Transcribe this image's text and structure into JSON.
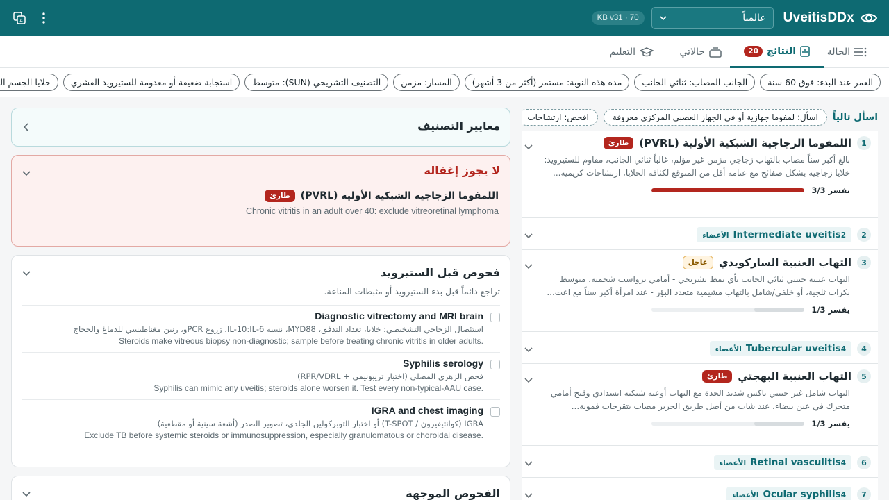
{
  "app": {
    "brand": "UveitisDDx",
    "region": "عالمياً",
    "kb_version": "KB v31 · 70"
  },
  "tabs": [
    {
      "label": "الحالة",
      "icon": "list-icon"
    },
    {
      "label": "النتائج",
      "count": "20",
      "icon": "chart-doc-icon",
      "active": true
    },
    {
      "label": "حالاتي",
      "icon": "stack-icon"
    },
    {
      "label": "التعليم",
      "icon": "graduation-cap-icon"
    }
  ],
  "chips": [
    "العمر عند البدء: فوق 60 سنة",
    "الجانب المصاب: ثنائي الجانب",
    "مدة هذه النوبة: مستمر (أكثر من 3 أشهر)",
    "المسار: مزمن",
    "التصنيف التشريحي (SUN): متوسط",
    "استجابة ضعيفة أو معدومة للستيرويد القشري",
    "خلايا الجسم الزجاجي"
  ],
  "ask_next": {
    "label": "اسأل تالياً",
    "items": [
      "اسأل: لمفوما جهازية أو في الجهاز العصبي المركزي معروفة",
      "افحص: ارتشاحات"
    ]
  },
  "results": [
    {
      "rank": "1",
      "title": "اللمفوما الزجاجية الشبكية الأولية (PVRL)",
      "badge": "طارئ",
      "badge_type": "red",
      "desc": "بالغ أكبر سناً مصاب بالتهاب زجاجي مزمن غير مؤلم، غالباً ثنائي الجانب، مقاوم للستيرويد: خلايا زجاجية بشكل صفائح مع عتامة أقل من المتوقع لكثافة الخلايا، ارتشاحات كريمية...",
      "explain_label": "يفسر 3/3",
      "explain": 1.0,
      "explain_color": "#b3261e"
    },
    {
      "rank": "2",
      "system_title": "Intermediate uveitis",
      "system_count": "2",
      "system_suffix": "الأعضاء"
    },
    {
      "rank": "3",
      "title": "التهاب العنبية الساركويدي",
      "badge": "عاجل",
      "badge_type": "amber",
      "desc": "التهاب عنبية حبيبي ثنائي الجانب بأي نمط تشريحي - أمامي برواسب شحمية، متوسط بكرات ثلجية، أو خلفي/شامل بالتهاب مشيمية متعدد البؤر - عند امرأة أكبر سناً مع اعت...",
      "explain_label": "يفسر 1/3",
      "explain": 0.33,
      "explain_color": "#e6e9eb"
    },
    {
      "rank": "4",
      "system_title": "Tubercular uveitis",
      "system_count": "4",
      "system_suffix": "الأعضاء"
    },
    {
      "rank": "5",
      "title": "التهاب العنبية البهجتي",
      "badge": "طارئ",
      "badge_type": "red",
      "desc": "التهاب شامل غير حبيبي ناكس شديد الحدة مع التهاب أوعية شبكية انسدادي وقيح أمامي متحرك في عين بيضاء، عند شاب من أصل طريق الحرير مصاب بتقرحات فموية...",
      "explain_label": "يفسر 1/3",
      "explain": 0.33,
      "explain_color": "#e6e9eb"
    },
    {
      "rank": "6",
      "system_title": "Retinal vasculitis",
      "system_count": "4",
      "system_suffix": "الأعضاء"
    },
    {
      "rank": "7",
      "system_title": "Ocular syphilis",
      "system_count": "4",
      "system_suffix": "الأعضاء"
    }
  ],
  "criteria": {
    "title": "معايير التصنيف"
  },
  "do_not_miss": {
    "title": "لا يجوز إغفاله",
    "item_title": "اللمفوما الزجاجية الشبكية الأولية (PVRL)",
    "item_badge": "طارئ",
    "reason": "Chronic vitritis in an adult over 40: exclude vitreoretinal lymphoma"
  },
  "pre_steroid": {
    "title": "فحوص قبل الستيرويد",
    "subtitle": "تراجع دائماً قبل بدء الستيرويد أو مثبطات المناعة.",
    "items": [
      {
        "title": "Diagnostic vitrectomy and MRI brain",
        "ar": "استئصال الزجاجي التشخيصي: خلايا، تعداد التدفق، MYD88، نسبة IL-10:IL-6، زروع PCRو، رنين مغناطيسي للدماغ والحجاج",
        "en": "Steroids make vitreous biopsy non-diagnostic; sample before treating chronic vitritis in older adults."
      },
      {
        "title": "Syphilis serology",
        "ar": "فحص الزهري المصلي (اختبار تريبونيمي + RPR/VDRL)",
        "en": "Syphilis can mimic any uveitis; steroids alone worsen it. Test every non-typical-AAU case."
      },
      {
        "title": "IGRA and chest imaging",
        "ar": "IGRA (كوانتيفيرون / T-SPOT) أو اختبار التوبركولين الجلدي، تصوير الصدر (أشعة سينية أو مقطعية)",
        "en": "Exclude TB before systemic steroids or immunosuppression, especially granulomatous or choroidal disease."
      }
    ]
  },
  "directed": {
    "title": "الفحوص الموجهة"
  }
}
